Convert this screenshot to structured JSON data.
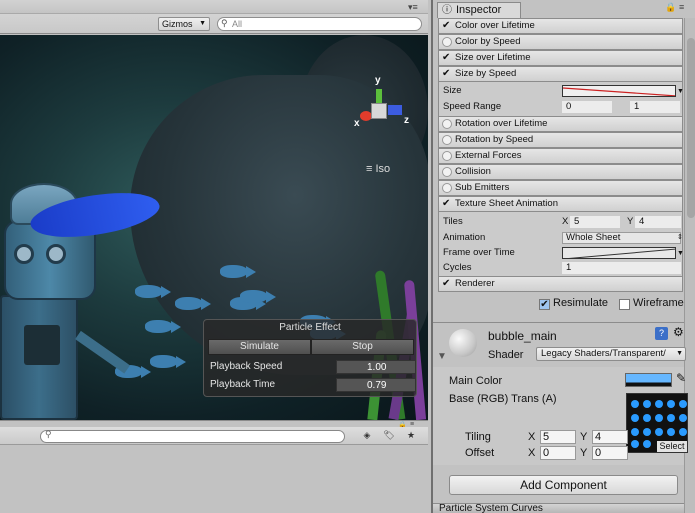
{
  "scene": {
    "gizmos_label": "Gizmos",
    "search_placeholder": "All",
    "gizmo_axes": {
      "y": "y",
      "x": "x",
      "z": "z"
    },
    "iso_label": "Iso"
  },
  "particle_effect": {
    "title": "Particle Effect",
    "simulate": "Simulate",
    "stop": "Stop",
    "playback_speed_label": "Playback Speed",
    "playback_speed": "1.00",
    "playback_time_label": "Playback Time",
    "playback_time": "0.79"
  },
  "inspector": {
    "tab": "Inspector",
    "modules_top": [
      {
        "label": "Color over Lifetime",
        "checked": true
      },
      {
        "label": "Color by Speed",
        "checked": false
      },
      {
        "label": "Size over Lifetime",
        "checked": true
      },
      {
        "label": "Size by Speed",
        "checked": true
      }
    ],
    "size_by_speed": {
      "size_label": "Size",
      "speed_range_label": "Speed Range",
      "speed_min": "0",
      "speed_max": "1"
    },
    "modules_mid": [
      {
        "label": "Rotation over Lifetime",
        "checked": false
      },
      {
        "label": "Rotation by Speed",
        "checked": false
      },
      {
        "label": "External Forces",
        "checked": false
      },
      {
        "label": "Collision",
        "checked": false
      },
      {
        "label": "Sub Emitters",
        "checked": false
      },
      {
        "label": "Texture Sheet Animation",
        "checked": true
      }
    ],
    "texture_sheet": {
      "tiles_label": "Tiles",
      "tiles_x_label": "X",
      "tiles_x": "5",
      "tiles_y_label": "Y",
      "tiles_y": "4",
      "animation_label": "Animation",
      "animation_value": "Whole Sheet",
      "frame_label": "Frame over Time",
      "cycles_label": "Cycles",
      "cycles_value": "1"
    },
    "renderer": {
      "label": "Renderer",
      "checked": true
    },
    "resimulate_label": "Resimulate",
    "resimulate_checked": true,
    "wireframe_label": "Wireframe",
    "wireframe_checked": false,
    "material": {
      "name": "bubble_main",
      "shader_label": "Shader",
      "shader_value": "Legacy Shaders/Transparent/",
      "main_color_label": "Main Color",
      "main_color": "#66b7ff",
      "base_label": "Base (RGB) Trans (A)",
      "tiling_label": "Tiling",
      "tiling_x": "5",
      "tiling_y": "4",
      "offset_label": "Offset",
      "offset_x": "0",
      "offset_y": "0",
      "axis_x": "X",
      "axis_y": "Y",
      "select_label": "Select"
    },
    "add_component": "Add Component",
    "next_panel": "Particle System Curves"
  }
}
